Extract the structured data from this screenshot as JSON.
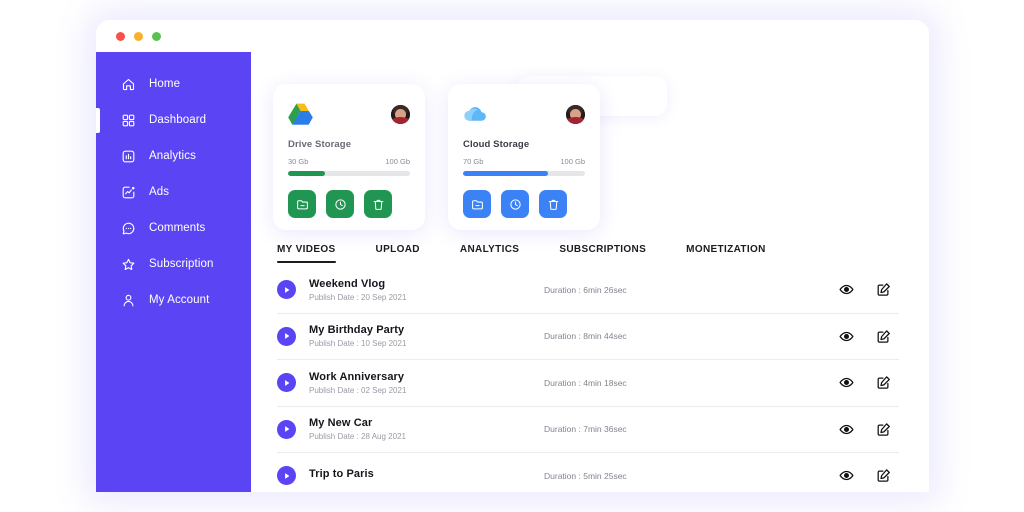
{
  "window": {
    "traffic_lights": [
      "close",
      "minimize",
      "maximize"
    ]
  },
  "colors": {
    "sidebar": "#5B44F4",
    "accent_purple": "#5B44F4",
    "drive_green": "#219653",
    "cloud_blue": "#3B82F6"
  },
  "sidebar": {
    "items": [
      {
        "label": "Home",
        "icon": "home-icon",
        "active": false
      },
      {
        "label": "Dashboard",
        "icon": "dashboard-grid-icon",
        "active": true
      },
      {
        "label": "Analytics",
        "icon": "analytics-bar-icon",
        "active": false
      },
      {
        "label": "Ads",
        "icon": "ads-chart-icon",
        "active": false
      },
      {
        "label": "Comments",
        "icon": "comments-bubble-icon",
        "active": false
      },
      {
        "label": "Subscription",
        "icon": "star-icon",
        "active": false
      },
      {
        "label": "My Account",
        "icon": "user-icon",
        "active": false
      }
    ]
  },
  "cards": [
    {
      "brand_icon": "google-drive-icon",
      "avatar": "user-avatar",
      "title": "Drive Storage",
      "used": "30 Gb",
      "total": "100 Gb",
      "percent": 30,
      "color": "#219653",
      "actions": [
        {
          "icon": "folder-minus-icon",
          "name": "remove-folder-button"
        },
        {
          "icon": "clock-icon",
          "name": "history-button"
        },
        {
          "icon": "trash-icon",
          "name": "delete-button"
        }
      ]
    },
    {
      "brand_icon": "cloud-icon",
      "avatar": "user-avatar",
      "title": "Cloud Storage",
      "used": "70 Gb",
      "total": "100 Gb",
      "percent": 70,
      "color": "#3B82F6",
      "actions": [
        {
          "icon": "folder-minus-icon",
          "name": "remove-folder-button"
        },
        {
          "icon": "clock-icon",
          "name": "history-button"
        },
        {
          "icon": "trash-icon",
          "name": "delete-button"
        }
      ]
    }
  ],
  "tabs": [
    {
      "label": "MY VIDEOS",
      "active": true
    },
    {
      "label": "UPLOAD",
      "active": false
    },
    {
      "label": "ANALYTICS",
      "active": false
    },
    {
      "label": "SUBSCRIPTIONS",
      "active": false
    },
    {
      "label": "MONETIZATION",
      "active": false
    }
  ],
  "videos": [
    {
      "title": "Weekend Vlog",
      "date": "Publish Date : 20 Sep 2021",
      "duration": "Duration : 6min 26sec"
    },
    {
      "title": "My Birthday Party",
      "date": "Publish Date : 10 Sep 2021",
      "duration": "Duration : 8min 44sec"
    },
    {
      "title": "Work Anniversary",
      "date": "Publish Date : 02 Sep 2021",
      "duration": "Duration : 4min 18sec"
    },
    {
      "title": "My New Car",
      "date": "Publish Date : 28 Aug 2021",
      "duration": "Duration : 7min 36sec"
    },
    {
      "title": "Trip to Paris",
      "date": "",
      "duration": "Duration : 5min 25sec"
    }
  ],
  "row_actions": [
    {
      "icon": "eye-icon",
      "name": "view-button"
    },
    {
      "icon": "edit-icon",
      "name": "edit-button"
    }
  ]
}
